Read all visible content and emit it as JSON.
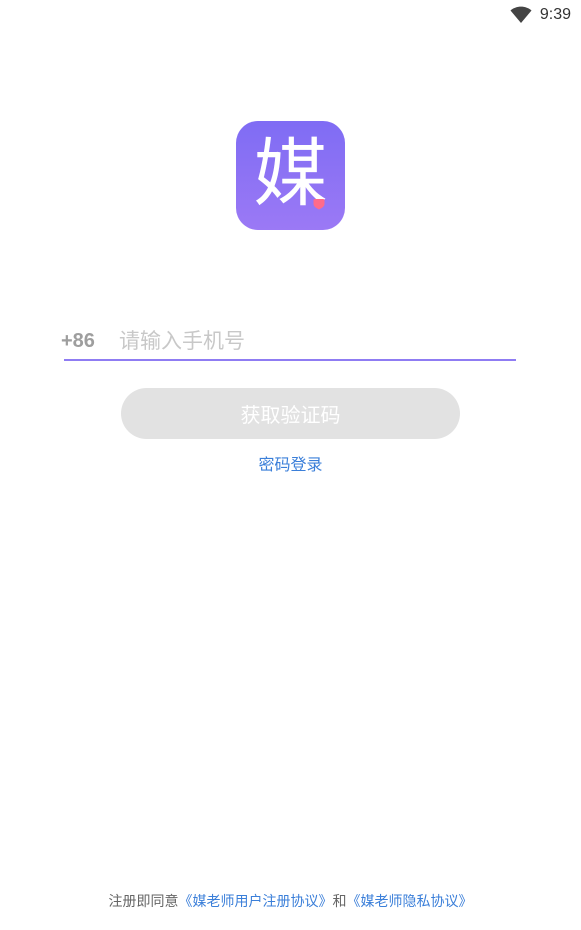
{
  "status_bar": {
    "time": "9:39",
    "wifi_icon": "wifi-icon"
  },
  "logo": {
    "char": "媒",
    "gradient_top": "#7f6cf4",
    "gradient_bottom": "#9b79f5",
    "heart_color": "#ff6b8a"
  },
  "login": {
    "country_code": "+86",
    "phone_placeholder": "请输入手机号",
    "phone_value": "",
    "get_code_label": "获取验证码",
    "password_login_label": "密码登录"
  },
  "agreement": {
    "prefix": "注册即同意",
    "user_agreement": "《媒老师用户注册协议》",
    "conjunction": "和",
    "privacy_agreement": "《媒老师隐私协议》"
  },
  "colors": {
    "accent": "#8f7cf3",
    "link": "#3b7fd9",
    "button_disabled": "#e2e2e2"
  }
}
